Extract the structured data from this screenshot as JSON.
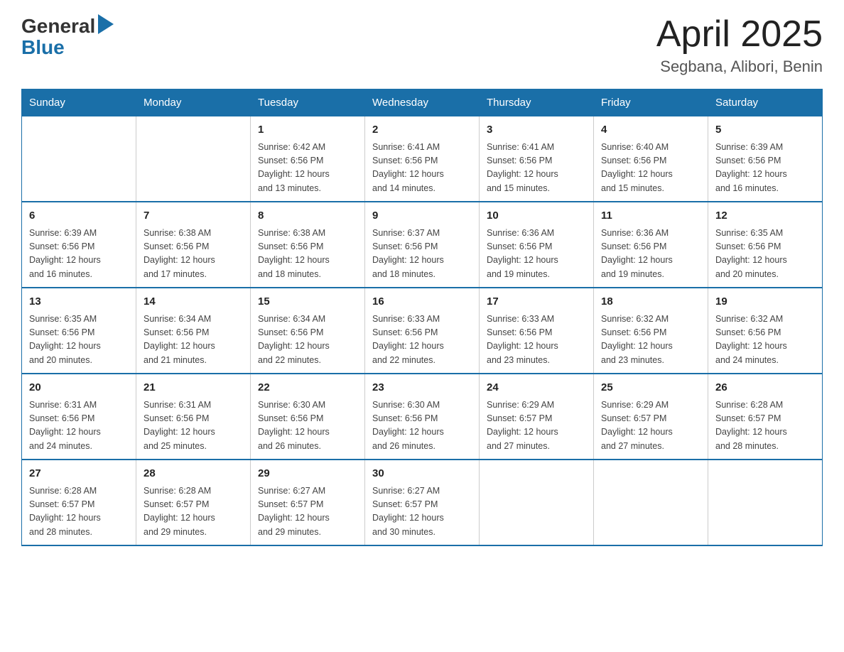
{
  "header": {
    "logo_general": "General",
    "logo_blue": "Blue",
    "title": "April 2025",
    "subtitle": "Segbana, Alibori, Benin"
  },
  "weekdays": [
    "Sunday",
    "Monday",
    "Tuesday",
    "Wednesday",
    "Thursday",
    "Friday",
    "Saturday"
  ],
  "weeks": [
    [
      {
        "day": "",
        "info": ""
      },
      {
        "day": "",
        "info": ""
      },
      {
        "day": "1",
        "info": "Sunrise: 6:42 AM\nSunset: 6:56 PM\nDaylight: 12 hours\nand 13 minutes."
      },
      {
        "day": "2",
        "info": "Sunrise: 6:41 AM\nSunset: 6:56 PM\nDaylight: 12 hours\nand 14 minutes."
      },
      {
        "day": "3",
        "info": "Sunrise: 6:41 AM\nSunset: 6:56 PM\nDaylight: 12 hours\nand 15 minutes."
      },
      {
        "day": "4",
        "info": "Sunrise: 6:40 AM\nSunset: 6:56 PM\nDaylight: 12 hours\nand 15 minutes."
      },
      {
        "day": "5",
        "info": "Sunrise: 6:39 AM\nSunset: 6:56 PM\nDaylight: 12 hours\nand 16 minutes."
      }
    ],
    [
      {
        "day": "6",
        "info": "Sunrise: 6:39 AM\nSunset: 6:56 PM\nDaylight: 12 hours\nand 16 minutes."
      },
      {
        "day": "7",
        "info": "Sunrise: 6:38 AM\nSunset: 6:56 PM\nDaylight: 12 hours\nand 17 minutes."
      },
      {
        "day": "8",
        "info": "Sunrise: 6:38 AM\nSunset: 6:56 PM\nDaylight: 12 hours\nand 18 minutes."
      },
      {
        "day": "9",
        "info": "Sunrise: 6:37 AM\nSunset: 6:56 PM\nDaylight: 12 hours\nand 18 minutes."
      },
      {
        "day": "10",
        "info": "Sunrise: 6:36 AM\nSunset: 6:56 PM\nDaylight: 12 hours\nand 19 minutes."
      },
      {
        "day": "11",
        "info": "Sunrise: 6:36 AM\nSunset: 6:56 PM\nDaylight: 12 hours\nand 19 minutes."
      },
      {
        "day": "12",
        "info": "Sunrise: 6:35 AM\nSunset: 6:56 PM\nDaylight: 12 hours\nand 20 minutes."
      }
    ],
    [
      {
        "day": "13",
        "info": "Sunrise: 6:35 AM\nSunset: 6:56 PM\nDaylight: 12 hours\nand 20 minutes."
      },
      {
        "day": "14",
        "info": "Sunrise: 6:34 AM\nSunset: 6:56 PM\nDaylight: 12 hours\nand 21 minutes."
      },
      {
        "day": "15",
        "info": "Sunrise: 6:34 AM\nSunset: 6:56 PM\nDaylight: 12 hours\nand 22 minutes."
      },
      {
        "day": "16",
        "info": "Sunrise: 6:33 AM\nSunset: 6:56 PM\nDaylight: 12 hours\nand 22 minutes."
      },
      {
        "day": "17",
        "info": "Sunrise: 6:33 AM\nSunset: 6:56 PM\nDaylight: 12 hours\nand 23 minutes."
      },
      {
        "day": "18",
        "info": "Sunrise: 6:32 AM\nSunset: 6:56 PM\nDaylight: 12 hours\nand 23 minutes."
      },
      {
        "day": "19",
        "info": "Sunrise: 6:32 AM\nSunset: 6:56 PM\nDaylight: 12 hours\nand 24 minutes."
      }
    ],
    [
      {
        "day": "20",
        "info": "Sunrise: 6:31 AM\nSunset: 6:56 PM\nDaylight: 12 hours\nand 24 minutes."
      },
      {
        "day": "21",
        "info": "Sunrise: 6:31 AM\nSunset: 6:56 PM\nDaylight: 12 hours\nand 25 minutes."
      },
      {
        "day": "22",
        "info": "Sunrise: 6:30 AM\nSunset: 6:56 PM\nDaylight: 12 hours\nand 26 minutes."
      },
      {
        "day": "23",
        "info": "Sunrise: 6:30 AM\nSunset: 6:56 PM\nDaylight: 12 hours\nand 26 minutes."
      },
      {
        "day": "24",
        "info": "Sunrise: 6:29 AM\nSunset: 6:57 PM\nDaylight: 12 hours\nand 27 minutes."
      },
      {
        "day": "25",
        "info": "Sunrise: 6:29 AM\nSunset: 6:57 PM\nDaylight: 12 hours\nand 27 minutes."
      },
      {
        "day": "26",
        "info": "Sunrise: 6:28 AM\nSunset: 6:57 PM\nDaylight: 12 hours\nand 28 minutes."
      }
    ],
    [
      {
        "day": "27",
        "info": "Sunrise: 6:28 AM\nSunset: 6:57 PM\nDaylight: 12 hours\nand 28 minutes."
      },
      {
        "day": "28",
        "info": "Sunrise: 6:28 AM\nSunset: 6:57 PM\nDaylight: 12 hours\nand 29 minutes."
      },
      {
        "day": "29",
        "info": "Sunrise: 6:27 AM\nSunset: 6:57 PM\nDaylight: 12 hours\nand 29 minutes."
      },
      {
        "day": "30",
        "info": "Sunrise: 6:27 AM\nSunset: 6:57 PM\nDaylight: 12 hours\nand 30 minutes."
      },
      {
        "day": "",
        "info": ""
      },
      {
        "day": "",
        "info": ""
      },
      {
        "day": "",
        "info": ""
      }
    ]
  ]
}
